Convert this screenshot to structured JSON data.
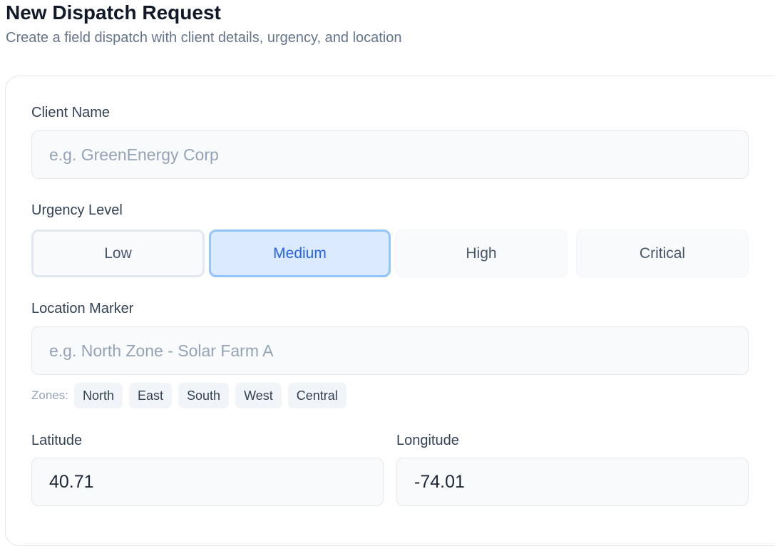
{
  "header": {
    "title": "New Dispatch Request",
    "subtitle": "Create a field dispatch with client details, urgency, and location"
  },
  "form": {
    "client_name": {
      "label": "Client Name",
      "placeholder": "e.g. GreenEnergy Corp",
      "value": ""
    },
    "urgency": {
      "label": "Urgency Level",
      "options": [
        "Low",
        "Medium",
        "High",
        "Critical"
      ],
      "selected": "Medium"
    },
    "location": {
      "label": "Location Marker",
      "placeholder": "e.g. North Zone - Solar Farm A",
      "value": ""
    },
    "zones": {
      "label": "Zones:",
      "items": [
        "North",
        "East",
        "South",
        "West",
        "Central"
      ]
    },
    "latitude": {
      "label": "Latitude",
      "value": "40.71"
    },
    "longitude": {
      "label": "Longitude",
      "value": "-74.01"
    }
  },
  "colors": {
    "selected_bg": "#dbeafe",
    "selected_border": "#93c5fd",
    "selected_text": "#2563eb",
    "input_bg": "#f8fafc"
  }
}
